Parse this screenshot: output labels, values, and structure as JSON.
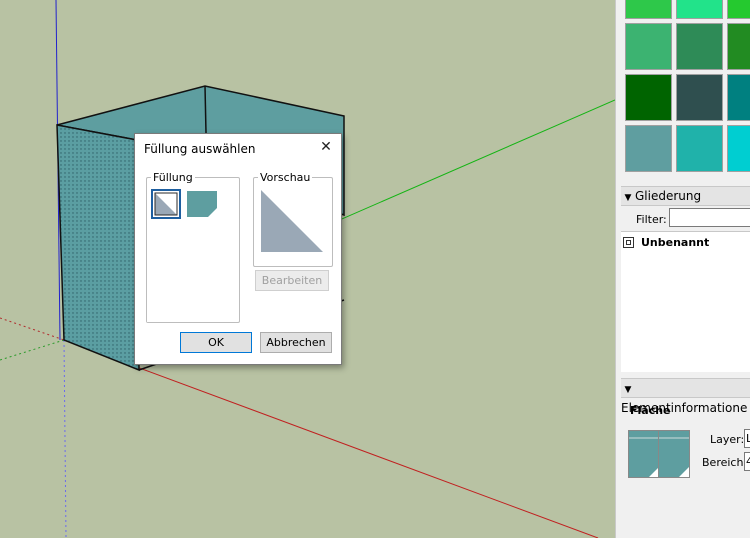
{
  "dialog": {
    "title": "Füllung auswählen",
    "fill_group_label": "Füllung",
    "preview_group_label": "Vorschau",
    "edit_button": "Bearbeiten",
    "ok_button": "OK",
    "cancel_button": "Abbrechen"
  },
  "tray": {
    "swatch_colors": [
      [
        "#2ec84a",
        "#22e38a",
        "#25c92f"
      ],
      [
        "#3cb371",
        "#2e8b57",
        "#228b22"
      ],
      [
        "#006400",
        "#2f4f4f",
        "#008080"
      ],
      [
        "#5f9ea0",
        "#20b2aa",
        "#00ced1"
      ]
    ],
    "outliner": {
      "header": "Gliederung",
      "filter_label": "Filter:",
      "filter_value": "",
      "root_item": "Unbenannt"
    },
    "entity_info": {
      "header": "Elementinformatione",
      "type_label": "Fläche",
      "layer_label": "Layer:",
      "layer_value": "L",
      "area_label": "Bereich:",
      "area_value": "4"
    }
  },
  "colors": {
    "viewport_background": "#b8c2a3",
    "face_color": "#5e9ea0",
    "dialog_accent": "#0078d7"
  }
}
